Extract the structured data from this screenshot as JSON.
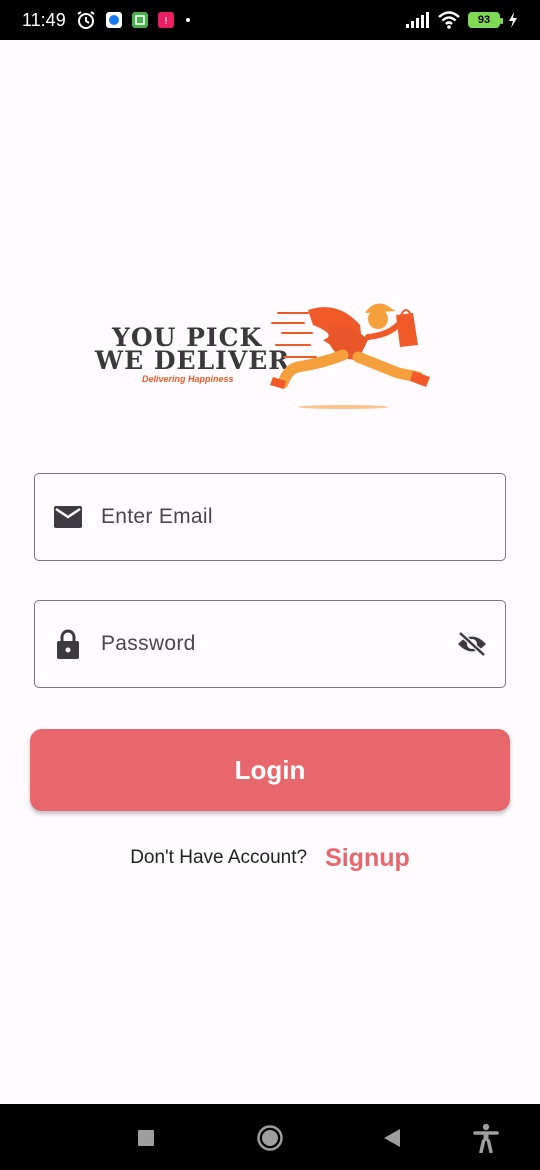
{
  "status_bar": {
    "time": "11:49",
    "battery_level": "93",
    "icons": [
      "alarm-icon",
      "messenger-icon",
      "app-icon",
      "notification-icon",
      "signal-icon",
      "wifi-icon",
      "battery-icon",
      "charging-icon"
    ]
  },
  "logo": {
    "line1": "YOU PICK",
    "line2": "WE DELIVER",
    "tagline": "Delivering Happiness"
  },
  "form": {
    "email_placeholder": "Enter Email",
    "password_placeholder": "Password",
    "email_icon": "mail-icon",
    "password_icon": "lock-icon",
    "visibility_icon": "visibility-off-icon"
  },
  "login_button": {
    "label": "Login"
  },
  "signup": {
    "prompt": "Don't Have Account?",
    "link": "Signup"
  },
  "colors": {
    "accent": "#e8676d",
    "background": "#fffbfe",
    "logo_orange": "#f05a28"
  }
}
